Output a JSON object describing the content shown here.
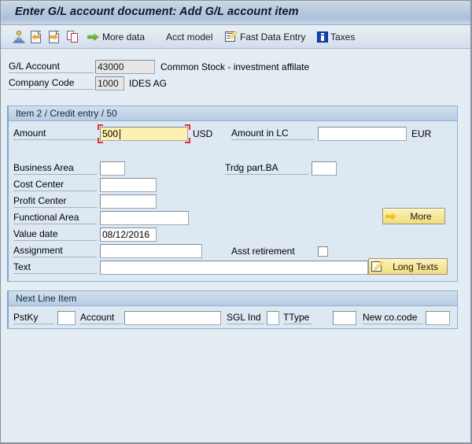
{
  "window": {
    "title": "Enter G/L account document: Add G/L account item"
  },
  "toolbar": {
    "items": [
      {
        "name": "account-assignment-icon",
        "label": ""
      },
      {
        "name": "previous-page-icon",
        "label": ""
      },
      {
        "name": "next-page-icon",
        "label": ""
      },
      {
        "name": "copy-icon",
        "label": ""
      },
      {
        "name": "more-data-button",
        "label": "More data"
      },
      {
        "name": "acct-model-button",
        "label": "Acct model"
      },
      {
        "name": "fast-data-entry-button",
        "label": "Fast Data Entry"
      },
      {
        "name": "taxes-button",
        "label": "Taxes"
      }
    ],
    "more_data_label": "More data",
    "acct_model_label": "Acct model",
    "fast_data_entry_label": "Fast Data Entry",
    "taxes_label": "Taxes"
  },
  "header": {
    "gl_account_label": "G/L Account",
    "gl_account_value": "43000",
    "gl_account_text": "Common Stock - investment affilate",
    "company_code_label": "Company Code",
    "company_code_value": "1000",
    "company_code_text": "IDES AG"
  },
  "item_group": {
    "title": "Item 2 / Credit entry / 50",
    "amount_label": "Amount",
    "amount_value": "500",
    "amount_currency": "USD",
    "amount_lc_label": "Amount in LC",
    "amount_lc_value": "",
    "amount_lc_currency": "EUR",
    "business_area_label": "Business Area",
    "business_area_value": "",
    "trdg_part_ba_label": "Trdg part.BA",
    "trdg_part_ba_value": "",
    "cost_center_label": "Cost Center",
    "cost_center_value": "",
    "profit_center_label": "Profit Center",
    "profit_center_value": "",
    "functional_area_label": "Functional Area",
    "functional_area_value": "",
    "value_date_label": "Value date",
    "value_date_value": "08/12/2016",
    "assignment_label": "Assignment",
    "assignment_value": "",
    "asst_retirement_label": "Asst retirement",
    "asst_retirement_checked": false,
    "text_label": "Text",
    "text_value": "",
    "more_button_label": "More",
    "long_texts_button_label": "Long Texts"
  },
  "next_line_item": {
    "title": "Next Line Item",
    "pstky_label": "PstKy",
    "pstky_value": "",
    "account_label": "Account",
    "account_value": "",
    "sgl_ind_label": "SGL Ind",
    "sgl_ind_value": "",
    "ttype_label": "TType",
    "ttype_value": "",
    "new_co_code_label": "New co.code",
    "new_co_code_value": ""
  },
  "colors": {
    "title_bar": "#b4c8de",
    "group_bg": "#dde8f3",
    "page_bg": "#e4ecf4",
    "focus_field": "#fdf0b0",
    "focus_mark": "#e03030",
    "button_yellow": "#f7e79a"
  }
}
